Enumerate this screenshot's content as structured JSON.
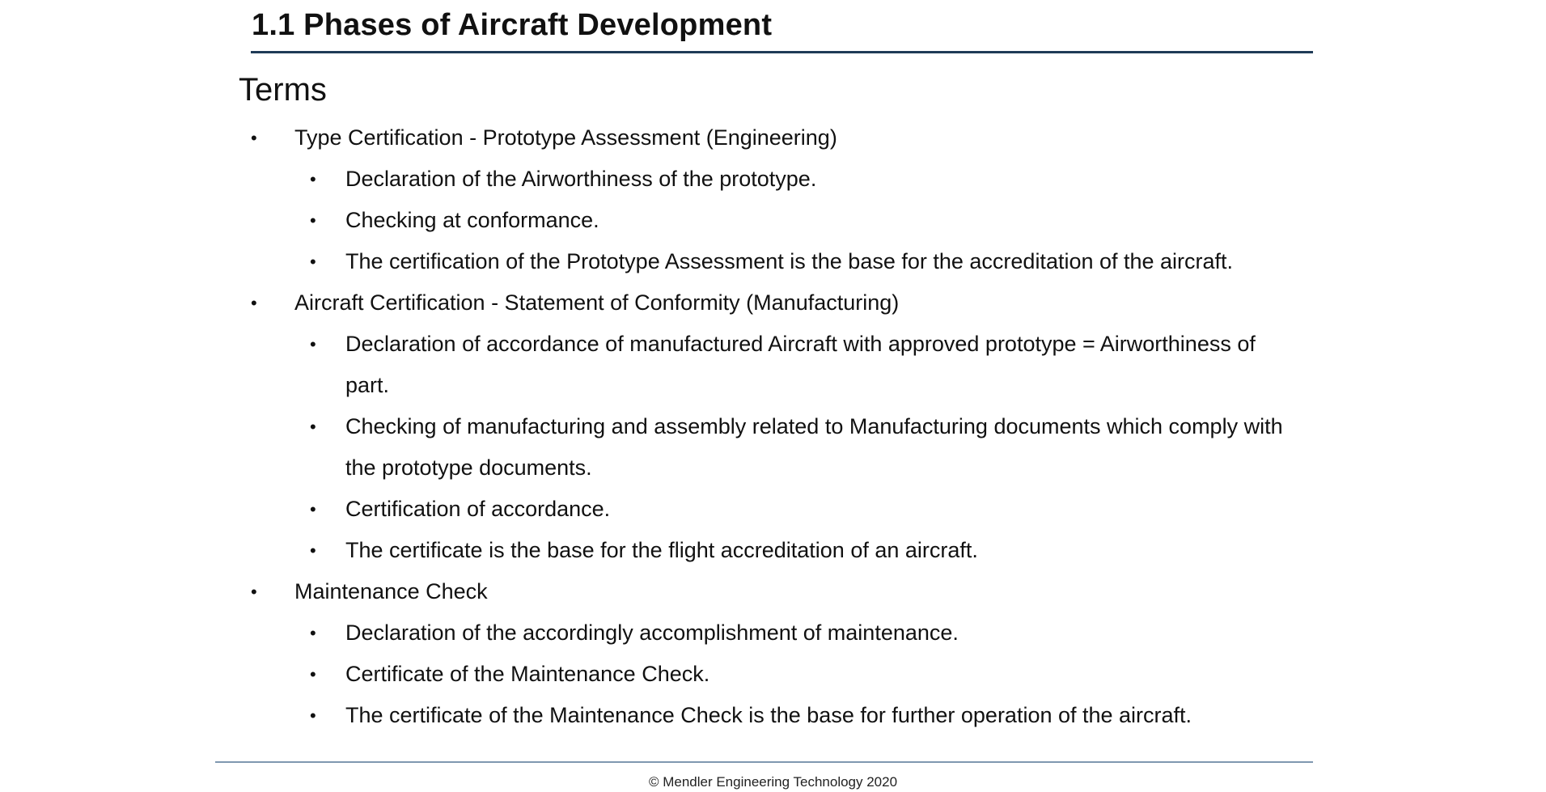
{
  "slide": {
    "title": "1.1 Phases of Aircraft Development",
    "section_heading": "Terms",
    "footer": "© Mendler Engineering Technology 2020",
    "bullets": [
      {
        "level": 1,
        "text": "Type Certification - Prototype Assessment (Engineering)"
      },
      {
        "level": 2,
        "text": "Declaration of the Airworthiness of the prototype."
      },
      {
        "level": 2,
        "text": "Checking at conformance."
      },
      {
        "level": 2,
        "text": "The certification of the Prototype Assessment is the base for the accreditation of the aircraft."
      },
      {
        "level": 1,
        "text": "Aircraft Certification - Statement of Conformity (Manufacturing)"
      },
      {
        "level": 2,
        "text": "Declaration of accordance of manufactured Aircraft with approved prototype = Airworthiness of part."
      },
      {
        "level": 2,
        "text": "Checking of manufacturing and assembly related to Manufacturing documents which comply with the prototype documents."
      },
      {
        "level": 2,
        "text": "Certification of accordance."
      },
      {
        "level": 2,
        "text": "The certificate is the base for the flight accreditation of an aircraft."
      },
      {
        "level": 1,
        "text": "Maintenance Check"
      },
      {
        "level": 2,
        "text": "Declaration of the accordingly accomplishment of maintenance."
      },
      {
        "level": 2,
        "text": "Certificate of the Maintenance Check."
      },
      {
        "level": 2,
        "text": "The certificate of the Maintenance Check is the base for further operation of the aircraft."
      }
    ]
  }
}
